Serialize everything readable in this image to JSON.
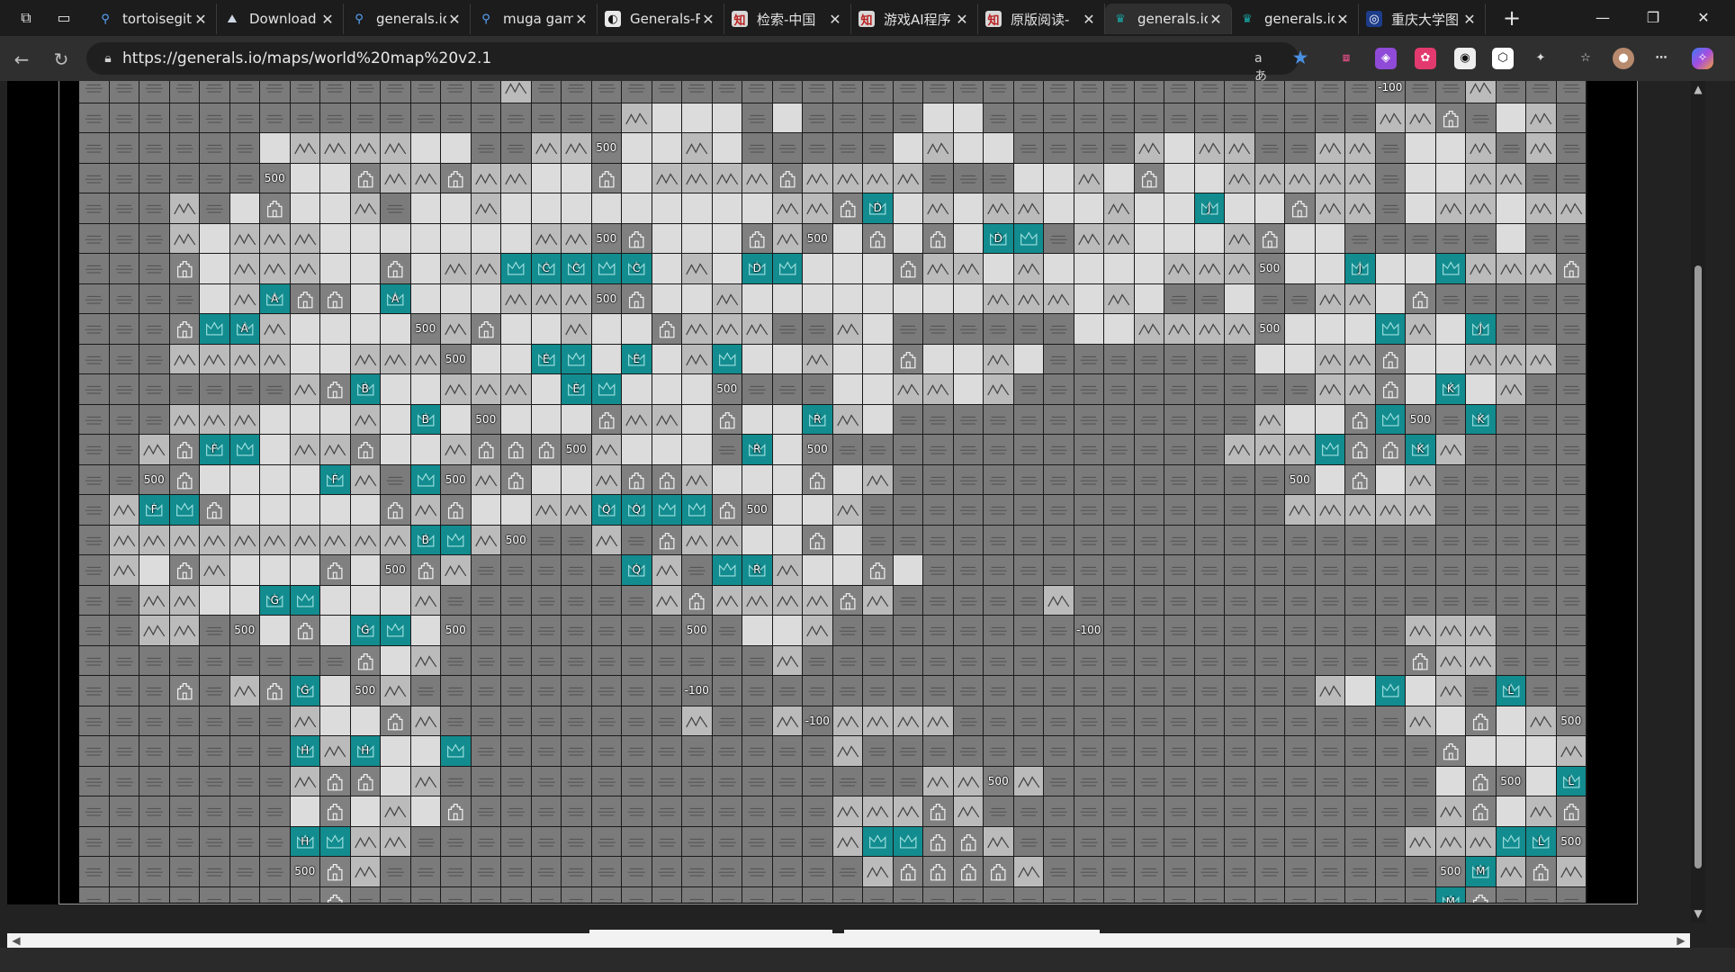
{
  "window": {
    "minimize": "—",
    "restore": "❐",
    "close": "✕"
  },
  "tabs": [
    {
      "title": "tortoisegit",
      "icon": "search-icon",
      "active": false
    },
    {
      "title": "Download",
      "icon": "download-page-icon",
      "active": false
    },
    {
      "title": "generals.io",
      "icon": "search-icon",
      "active": false
    },
    {
      "title": "muga gam",
      "icon": "search-icon",
      "active": false
    },
    {
      "title": "Generals-F",
      "icon": "github-icon",
      "active": false
    },
    {
      "title": "检索-中国",
      "icon": "cnki-icon",
      "active": false
    },
    {
      "title": "游戏AI程序",
      "icon": "cnki-icon",
      "active": false
    },
    {
      "title": "原版阅读-",
      "icon": "cnki-icon",
      "active": false
    },
    {
      "title": "generals.io",
      "icon": "crown-icon",
      "active": true
    },
    {
      "title": "generals.io",
      "icon": "crown-icon",
      "active": false
    },
    {
      "title": "重庆大学图",
      "icon": "university-icon",
      "active": false
    }
  ],
  "address_bar": {
    "url": "https://generals.io/maps/world%20map%20v2.1",
    "read_aloud": "aあ"
  },
  "map": {
    "name": "world map v2.1",
    "rows": [
      "FFFFFFFFFFFFFFMFFFFFFFFFFFFFFFFFFFFFFFFFFFFVFFMFFFFF",
      "FFFFFFFFFFFFFFFFFFM...F.FFFF..FFFFFFFFFFFFFMMCF.MFF",
      "FFFFFF.MMMM..FFMM5..M.FFFFF.M..FFFFM.MMFFMMF..MFMFF",
      "FFFFFF5..CMMCMM..C.MMMMCMMMMFFF..M.C..MMMMMF..MMFF",
      "FFFMF.C..MF..M.........MMC1.M.MM..M..1..CMMF.MM.MM",
      "FFFM.MMM.......MM5C...CM5.C.C.M1FMM...MC..FFFFF.FF",
      "FFFC.MMM..C.MM1MM1..M..1...CMM.M....MMM5.....1MMMCM",
      "FFFF.M2CC.2...MMM5C..M........MMM.M.FF.FFMM.CFFFFF",
      "FFFC2MM....5MC..M..CMMMFFM.FFFFFF..MMMM5...1M.FFF",
      "FFFMMMM..MMM5...1...M1..M..C..M.FFFFFFF..MMC..MMMFF",
      "FFFFFFFMCC..MMM..1...5FFF..MM.MFFFFFFFFFFMMC.1.MFFF",
      "FFFMMM...M.1.5...CMM.C..1M.FFFFFFFFFFFFM..C15FFFFF",
      "FFMCF1.MMC..MCCC5M...F1.5FFFFFFFFFFFFFMMM1CCMMFFF",
      "FF5C....CMF15MC..MCCM...C.MFFFFFFFFFFFFF5.C.MFFFF",
      "FMF1C.....CMC..MMCF11C5..MFFFFFFFFFFFFFFMMMMMFFFF",
      "FMMMMMMMMMM.1M5FFMFCMM..C.FFFFFFFFFFFFFFFFFFFFFFFFF",
      "FM.CM...C.5CMFFFFFFMF1MM..C.FFFFFFFFFFFFFFFFFFFFF",
      "FFMM...1...MFFFFFFFMCMMMMCMFFFFFMFFFFFFFFFFFFFFFF",
      "FFMMF5.C..1.5FFFFFFF5F..MFFFFFFFF0FFFFFFFFFFMMMFFF",
      "FFFFFFFFFC.MFFFFFFFFFFFMFFFFFFFFFFFFFFFFFFFFCMMFFF",
      "FFFCFMC1.5MFFFFFFFFF0FFFFFFFFFFFFFFFFFFFFM.1.MFFF",
      "FFFFFFFM..CMFFFFFFFFMFFM0MMMMFFFFFFFFFFFFFFFM.C.M5M",
      "FFFFFFF.M1..1FFFFFFFFFFFFMFFFFFFFFFFFFFFFFFFFC...MM",
      "FFFFFFFMCC.MFFFFFFFFFFFFFFFFMM5MFFFFFFFFFFFFF.C5.1CM",
      "FFFFFFF.C.M.CFFFFFFFFFFFFMMMCMFFFFFFFFFFFFFFFMC.MCMM",
      "FFFFFFFM1MMFFFFFFFFFFFFFFM11CCMFFFFFFFFFFFFFMMM1C5",
      "FFFFFFF5CMFFFFFFFFFFFFFFFFMCCCCMFFFFFFFFFFFFF51MCMF",
      "FFFFFFFFCFFFFFFFFFFFFFFFFFFFFFFFFFFFFFFFFFFFF1CFFFF"
    ]
  },
  "generals": [
    {
      "r": 4,
      "c": 26,
      "letter": "D"
    },
    {
      "r": 5,
      "c": 30,
      "letter": "D"
    },
    {
      "r": 4,
      "c": 37,
      "letter": "J"
    },
    {
      "r": 6,
      "c": 15,
      "letter": "C"
    },
    {
      "r": 6,
      "c": 16,
      "letter": "C"
    },
    {
      "r": 6,
      "c": 18,
      "letter": "C"
    },
    {
      "r": 6,
      "c": 22,
      "letter": "D"
    },
    {
      "r": 6,
      "c": 42,
      "letter": "J"
    },
    {
      "r": 7,
      "c": 6,
      "letter": "A"
    },
    {
      "r": 7,
      "c": 10,
      "letter": "A"
    },
    {
      "r": 8,
      "c": 5,
      "letter": "A"
    },
    {
      "r": 8,
      "c": 46,
      "letter": "J"
    },
    {
      "r": 9,
      "c": 15,
      "letter": "E"
    },
    {
      "r": 9,
      "c": 18,
      "letter": "E"
    },
    {
      "r": 10,
      "c": 9,
      "letter": "B"
    },
    {
      "r": 10,
      "c": 16,
      "letter": "E"
    },
    {
      "r": 10,
      "c": 45,
      "letter": "K"
    },
    {
      "r": 11,
      "c": 11,
      "letter": "B"
    },
    {
      "r": 11,
      "c": 24,
      "letter": "R"
    },
    {
      "r": 11,
      "c": 46,
      "letter": "K"
    },
    {
      "r": 12,
      "c": 4,
      "letter": "F"
    },
    {
      "r": 12,
      "c": 22,
      "letter": "R"
    },
    {
      "r": 12,
      "c": 44,
      "letter": "K"
    },
    {
      "r": 13,
      "c": 8,
      "letter": "F"
    },
    {
      "r": 14,
      "c": 2,
      "letter": "F"
    },
    {
      "r": 14,
      "c": 17,
      "letter": "Q"
    },
    {
      "r": 14,
      "c": 18,
      "letter": "Q"
    },
    {
      "r": 15,
      "c": 11,
      "letter": "B"
    },
    {
      "r": 16,
      "c": 18,
      "letter": "Q"
    },
    {
      "r": 16,
      "c": 22,
      "letter": "R"
    },
    {
      "r": 17,
      "c": 6,
      "letter": "G"
    },
    {
      "r": 18,
      "c": 9,
      "letter": "G"
    },
    {
      "r": 20,
      "c": 7,
      "letter": "G"
    },
    {
      "r": 20,
      "c": 47,
      "letter": "L"
    },
    {
      "r": 22,
      "c": 7,
      "letter": "H"
    },
    {
      "r": 22,
      "c": 9,
      "letter": "H"
    },
    {
      "r": 23,
      "c": 49,
      "letter": "L"
    },
    {
      "r": 25,
      "c": 7,
      "letter": "H"
    },
    {
      "r": 25,
      "c": 48,
      "letter": "L"
    },
    {
      "r": 26,
      "c": 46,
      "letter": "M"
    },
    {
      "r": 27,
      "c": 45,
      "letter": "M"
    }
  ],
  "army_labels": {
    "city_500": "500",
    "swamp_neg": "-100"
  },
  "extensions": [
    {
      "name": "ext-1-icon"
    },
    {
      "name": "ext-2-icon"
    },
    {
      "name": "ext-3-icon"
    },
    {
      "name": "ext-4-icon"
    },
    {
      "name": "ext-5-icon"
    },
    {
      "name": "extensions-icon"
    }
  ],
  "colors": {
    "fog": "#7b7b7b",
    "plain": "#dcdcdc",
    "mountain": "#bbbbbb",
    "general": "#128c8f",
    "accent": "#19a6a6"
  }
}
